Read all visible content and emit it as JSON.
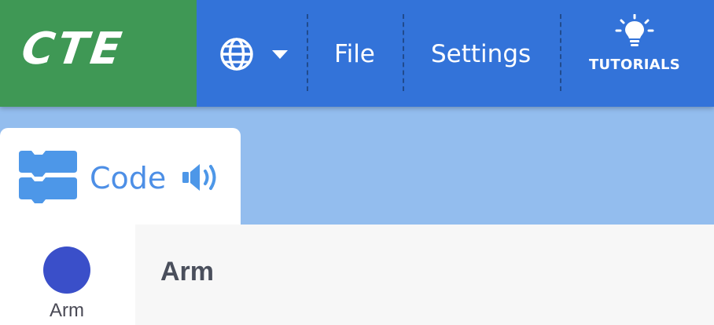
{
  "menubar": {
    "logo": "CTE",
    "file_label": "File",
    "settings_label": "Settings",
    "tutorials_label": "TUTORIALS"
  },
  "icons": {
    "language": "globe-icon",
    "dropdown": "chevron-down-icon",
    "tutorials": "lightbulb-icon",
    "code": "code-blocks-icon",
    "sound": "speaker-icon"
  },
  "tabs": [
    {
      "label": "Code",
      "selected": true
    }
  ],
  "sprite": {
    "name": "Arm",
    "color": "#3a4fc9"
  },
  "info": {
    "title": "Arm"
  },
  "colors": {
    "menubar": "#3373d9",
    "logo_bg": "#3f9855",
    "workspace_bg": "#93bdee",
    "tab_text": "#4d8fe6"
  }
}
